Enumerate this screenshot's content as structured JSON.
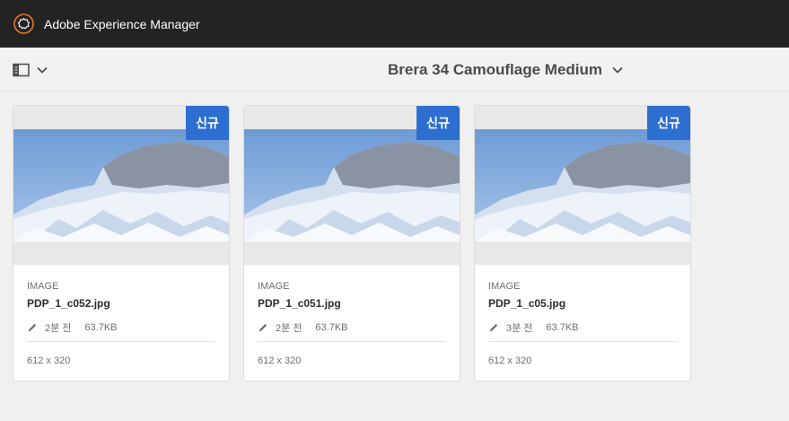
{
  "header": {
    "app_title": "Adobe Experience Manager",
    "logo_icon": "aem-logo-icon"
  },
  "actionbar": {
    "rail_icon": "rail-toggle-icon",
    "page_title": "Brera 34 Camouflage Medium"
  },
  "colors": {
    "topbar": "#232323",
    "badge": "#2d6fd0",
    "background": "#f0f0f0"
  },
  "cards": [
    {
      "badge": "신규",
      "type": "IMAGE",
      "name": "PDP_1_c052.jpg",
      "modified": "2분 전",
      "size": "63.7KB",
      "dimensions": "612 x 320"
    },
    {
      "badge": "신규",
      "type": "IMAGE",
      "name": "PDP_1_c051.jpg",
      "modified": "2분 전",
      "size": "63.7KB",
      "dimensions": "612 x 320"
    },
    {
      "badge": "신규",
      "type": "IMAGE",
      "name": "PDP_1_c05.jpg",
      "modified": "3분 전",
      "size": "63.7KB",
      "dimensions": "612 x 320"
    }
  ]
}
